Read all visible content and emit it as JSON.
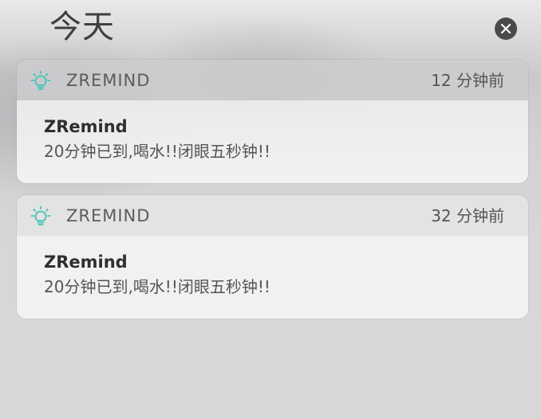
{
  "header": {
    "title": "今天",
    "close_icon": "close-icon"
  },
  "notifications": [
    {
      "app_icon": "lightbulb-icon",
      "app_name": "ZREMIND",
      "time": "12 分钟前",
      "title": "ZRemind",
      "message": "20分钟已到,喝水!!闭眼五秒钟!!"
    },
    {
      "app_icon": "lightbulb-icon",
      "app_name": "ZREMIND",
      "time": "32 分钟前",
      "title": "ZRemind",
      "message": "20分钟已到,喝水!!闭眼五秒钟!!"
    }
  ],
  "colors": {
    "icon_accent": "#3fc3b8",
    "close_button": "#4a4a4a"
  }
}
